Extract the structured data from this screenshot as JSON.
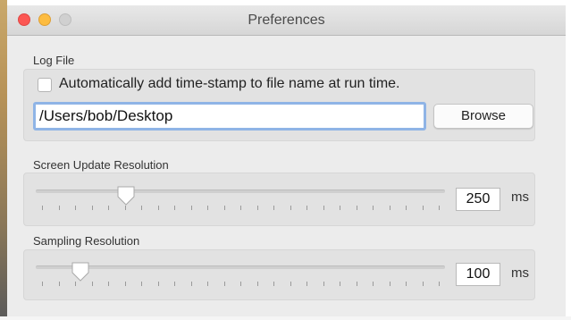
{
  "window": {
    "title": "Preferences"
  },
  "log_file": {
    "label": "Log File",
    "timestamp_checkbox_label": "Automatically add time-stamp to file name at run time.",
    "timestamp_checked": false,
    "path_value": "/Users/bob/Desktop",
    "browse_label": "Browse"
  },
  "screen_update": {
    "label": "Screen Update Resolution",
    "value": "250",
    "unit": "ms",
    "slider_fraction": 0.22
  },
  "sampling": {
    "label": "Sampling Resolution",
    "value": "100",
    "unit": "ms",
    "slider_fraction": 0.11
  },
  "colors": {
    "close": "#fc5753",
    "minimize": "#fdbc40",
    "zoom_disabled": "#d0d0d0",
    "focus_ring": "#8fb4e6"
  }
}
